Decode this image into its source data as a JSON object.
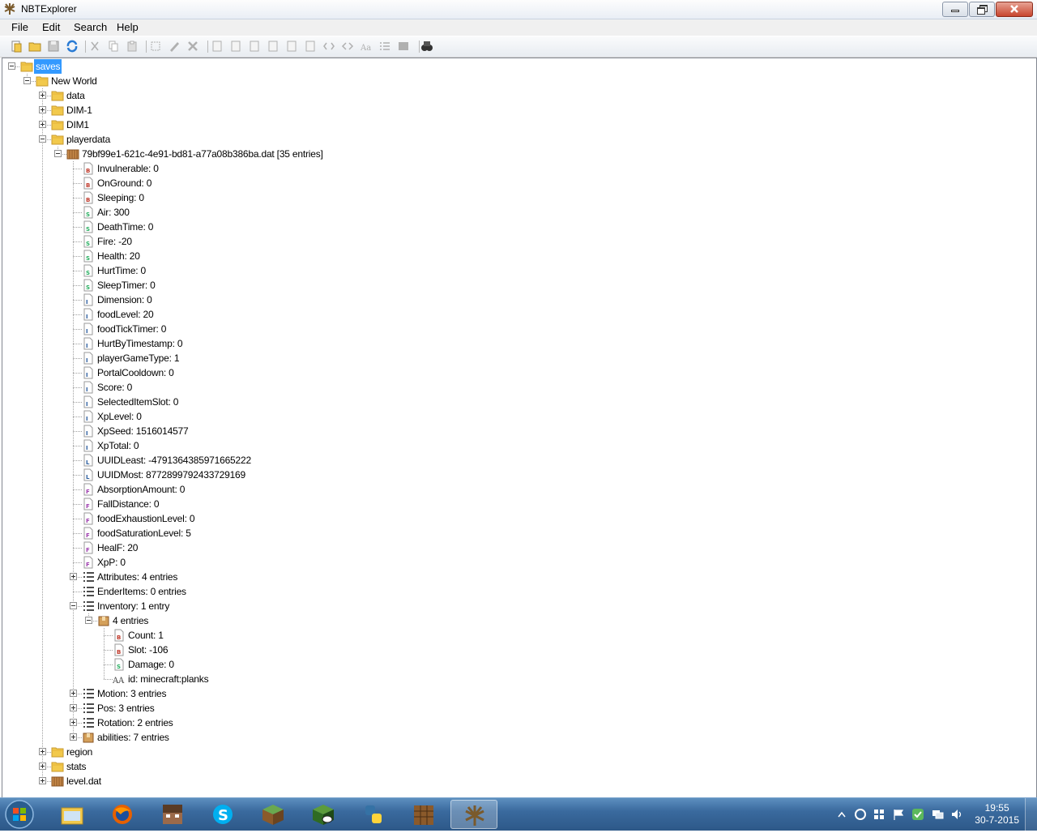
{
  "window": {
    "title": "NBTExplorer"
  },
  "menu": {
    "items": [
      "File",
      "Edit",
      "Search",
      "Help"
    ]
  },
  "toolbar": {
    "icons": [
      "open-icon",
      "open-folder-icon",
      "save-icon",
      "refresh-icon",
      "cut-icon",
      "copy-icon",
      "paste-icon",
      "rename-icon",
      "edit-icon",
      "delete-icon",
      "add-byte-icon",
      "add-short-icon",
      "add-int-icon",
      "add-long-icon",
      "add-float-icon",
      "add-double-icon",
      "add-byte-array-icon",
      "add-int-array-icon",
      "add-string-icon",
      "add-list-icon",
      "add-compound-icon",
      "find-icon"
    ]
  },
  "tree": {
    "nodes": [
      {
        "label": "saves",
        "depth": 0,
        "icon": "folder",
        "expander": "minus",
        "selected": true
      },
      {
        "label": "New World",
        "depth": 1,
        "icon": "folder",
        "expander": "minus"
      },
      {
        "label": "data",
        "depth": 2,
        "icon": "folder",
        "expander": "plus"
      },
      {
        "label": "DIM-1",
        "depth": 2,
        "icon": "folder",
        "expander": "plus"
      },
      {
        "label": "DIM1",
        "depth": 2,
        "icon": "folder",
        "expander": "plus"
      },
      {
        "label": "playerdata",
        "depth": 2,
        "icon": "folder",
        "expander": "minus"
      },
      {
        "label": "79bf99e1-621c-4e91-bd81-a77a08b386ba.dat [35 entries]",
        "depth": 3,
        "icon": "nbt-file",
        "expander": "minus"
      },
      {
        "label": "Invulnerable: 0",
        "depth": 4,
        "icon": "byte"
      },
      {
        "label": "OnGround: 0",
        "depth": 4,
        "icon": "byte"
      },
      {
        "label": "Sleeping: 0",
        "depth": 4,
        "icon": "byte"
      },
      {
        "label": "Air: 300",
        "depth": 4,
        "icon": "short"
      },
      {
        "label": "DeathTime: 0",
        "depth": 4,
        "icon": "short"
      },
      {
        "label": "Fire: -20",
        "depth": 4,
        "icon": "short"
      },
      {
        "label": "Health: 20",
        "depth": 4,
        "icon": "short"
      },
      {
        "label": "HurtTime: 0",
        "depth": 4,
        "icon": "short"
      },
      {
        "label": "SleepTimer: 0",
        "depth": 4,
        "icon": "short"
      },
      {
        "label": "Dimension: 0",
        "depth": 4,
        "icon": "int"
      },
      {
        "label": "foodLevel: 20",
        "depth": 4,
        "icon": "int"
      },
      {
        "label": "foodTickTimer: 0",
        "depth": 4,
        "icon": "int"
      },
      {
        "label": "HurtByTimestamp: 0",
        "depth": 4,
        "icon": "int"
      },
      {
        "label": "playerGameType: 1",
        "depth": 4,
        "icon": "int"
      },
      {
        "label": "PortalCooldown: 0",
        "depth": 4,
        "icon": "int"
      },
      {
        "label": "Score: 0",
        "depth": 4,
        "icon": "int"
      },
      {
        "label": "SelectedItemSlot: 0",
        "depth": 4,
        "icon": "int"
      },
      {
        "label": "XpLevel: 0",
        "depth": 4,
        "icon": "int"
      },
      {
        "label": "XpSeed: 1516014577",
        "depth": 4,
        "icon": "int"
      },
      {
        "label": "XpTotal: 0",
        "depth": 4,
        "icon": "int"
      },
      {
        "label": "UUIDLeast: -4791364385971665222",
        "depth": 4,
        "icon": "long"
      },
      {
        "label": "UUIDMost: 8772899792433729169",
        "depth": 4,
        "icon": "long"
      },
      {
        "label": "AbsorptionAmount: 0",
        "depth": 4,
        "icon": "float"
      },
      {
        "label": "FallDistance: 0",
        "depth": 4,
        "icon": "float"
      },
      {
        "label": "foodExhaustionLevel: 0",
        "depth": 4,
        "icon": "float"
      },
      {
        "label": "foodSaturationLevel: 5",
        "depth": 4,
        "icon": "float"
      },
      {
        "label": "HealF: 20",
        "depth": 4,
        "icon": "float"
      },
      {
        "label": "XpP: 0",
        "depth": 4,
        "icon": "float"
      },
      {
        "label": "Attributes: 4 entries",
        "depth": 4,
        "icon": "list",
        "expander": "plus"
      },
      {
        "label": "EnderItems: 0 entries",
        "depth": 4,
        "icon": "list"
      },
      {
        "label": "Inventory: 1 entry",
        "depth": 4,
        "icon": "list",
        "expander": "minus"
      },
      {
        "label": "4 entries",
        "depth": 5,
        "icon": "compound",
        "expander": "minus"
      },
      {
        "label": "Count: 1",
        "depth": 6,
        "icon": "byte"
      },
      {
        "label": "Slot: -106",
        "depth": 6,
        "icon": "byte"
      },
      {
        "label": "Damage: 0",
        "depth": 6,
        "icon": "short"
      },
      {
        "label": "id: minecraft:planks",
        "depth": 6,
        "icon": "string"
      },
      {
        "label": "Motion: 3 entries",
        "depth": 4,
        "icon": "list",
        "expander": "plus"
      },
      {
        "label": "Pos: 3 entries",
        "depth": 4,
        "icon": "list",
        "expander": "plus"
      },
      {
        "label": "Rotation: 2 entries",
        "depth": 4,
        "icon": "list",
        "expander": "plus"
      },
      {
        "label": "abilities: 7 entries",
        "depth": 4,
        "icon": "compound",
        "expander": "plus"
      },
      {
        "label": "region",
        "depth": 2,
        "icon": "folder",
        "expander": "plus"
      },
      {
        "label": "stats",
        "depth": 2,
        "icon": "folder",
        "expander": "plus"
      },
      {
        "label": "level.dat",
        "depth": 2,
        "icon": "nbt-file",
        "expander": "plus"
      }
    ]
  },
  "taskbar": {
    "apps": [
      "explorer-icon",
      "firefox-icon",
      "minecraft-head-icon",
      "skype-icon",
      "minecraft-grass-icon",
      "minecraft-launcher-icon",
      "python-icon",
      "crafting-table-icon",
      "nbtexplorer-icon"
    ],
    "active_app": 8,
    "clock": {
      "time": "19:55",
      "date": "30-7-2015"
    }
  },
  "colors": {
    "selection": "#3399ff",
    "taskbar": "#3a6a9e",
    "folder": "#f2c94c"
  }
}
